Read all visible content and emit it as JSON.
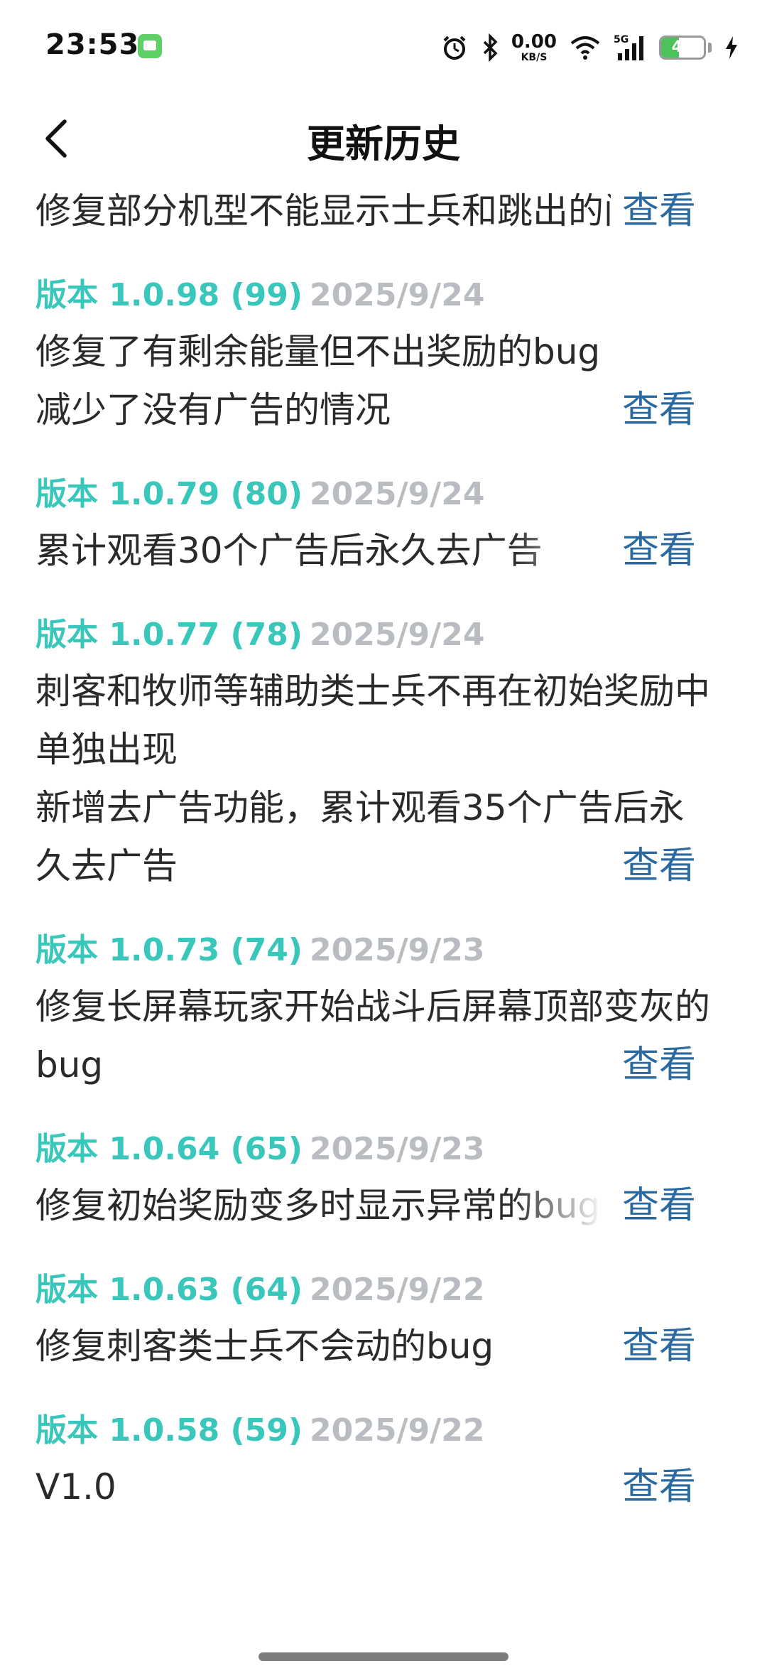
{
  "status_bar": {
    "time": "23:53",
    "net_speed_value": "0.00",
    "net_speed_unit": "KB/S",
    "signal_label": "5G",
    "battery_level": "41",
    "battery_fraction": 0.41,
    "icons": [
      "message-app-icon",
      "alarm-icon",
      "bluetooth-icon",
      "wifi-icon",
      "signal-icon",
      "battery-icon",
      "charging-icon"
    ]
  },
  "header": {
    "title": "更新历史"
  },
  "view_label": "查看",
  "entries": [
    {
      "version": "",
      "date": "",
      "description": "修复部分机型不能显示士兵和跳出的问题"
    },
    {
      "version": "版本 1.0.98 (99)",
      "date": "2025/9/24",
      "description": "修复了有剩余能量但不出奖励的bug\n减少了没有广告的情况"
    },
    {
      "version": "版本 1.0.79 (80)",
      "date": "2025/9/24",
      "description": "累计观看30个广告后永久去广告"
    },
    {
      "version": "版本 1.0.77 (78)",
      "date": "2025/9/24",
      "description": "刺客和牧师等辅助类士兵不再在初始奖励中单独出现\n新增去广告功能，累计观看35个广告后永久去广告"
    },
    {
      "version": "版本 1.0.73 (74)",
      "date": "2025/9/23",
      "description": "修复长屏幕玩家开始战斗后屏幕顶部变灰的bug"
    },
    {
      "version": "版本 1.0.64 (65)",
      "date": "2025/9/23",
      "description": "修复初始奖励变多时显示异常的bug"
    },
    {
      "version": "版本 1.0.63 (64)",
      "date": "2025/9/22",
      "description": "修复刺客类士兵不会动的bug"
    },
    {
      "version": "版本 1.0.58 (59)",
      "date": "2025/9/22",
      "description": "V1.0"
    }
  ]
}
